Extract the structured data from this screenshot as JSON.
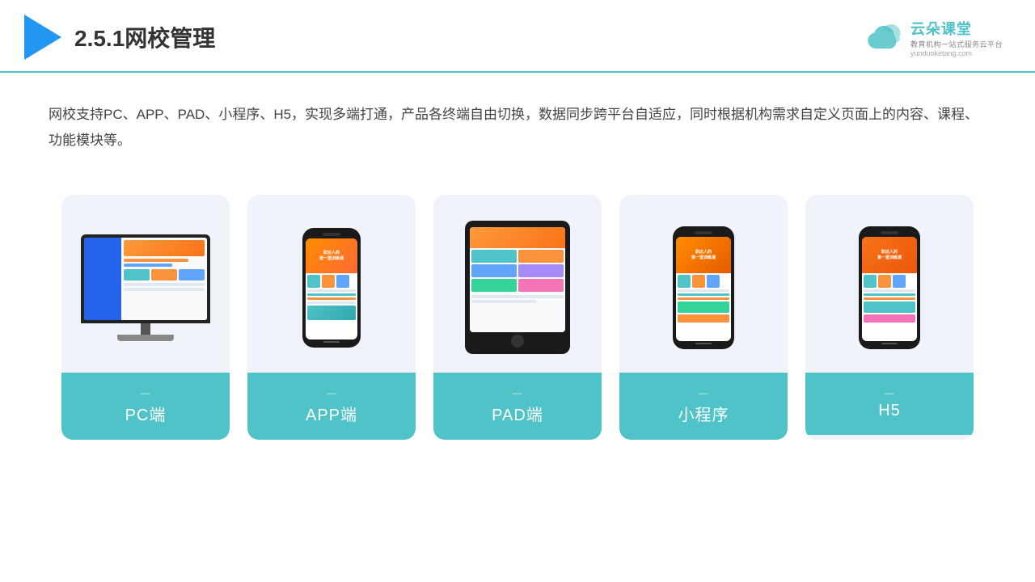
{
  "header": {
    "title": "2.5.1网校管理",
    "logo": {
      "main": "云朵课堂",
      "sub": "教育机构一站式服务云平台",
      "url": "yunduoketang.com"
    }
  },
  "description": "网校支持PC、APP、PAD、小程序、H5，实现多端打通，产品各终端自由切换，数据同步跨平台自适应，同时根据机构需求自定义页面上的内容、课程、功能模块等。",
  "cards": [
    {
      "id": "pc",
      "label": "PC端",
      "device_type": "monitor"
    },
    {
      "id": "app",
      "label": "APP端",
      "device_type": "phone"
    },
    {
      "id": "pad",
      "label": "PAD端",
      "device_type": "tablet"
    },
    {
      "id": "miniapp",
      "label": "小程序",
      "device_type": "phone2"
    },
    {
      "id": "h5",
      "label": "H5",
      "device_type": "phone3"
    }
  ],
  "accent_color": "#4FC3C8"
}
